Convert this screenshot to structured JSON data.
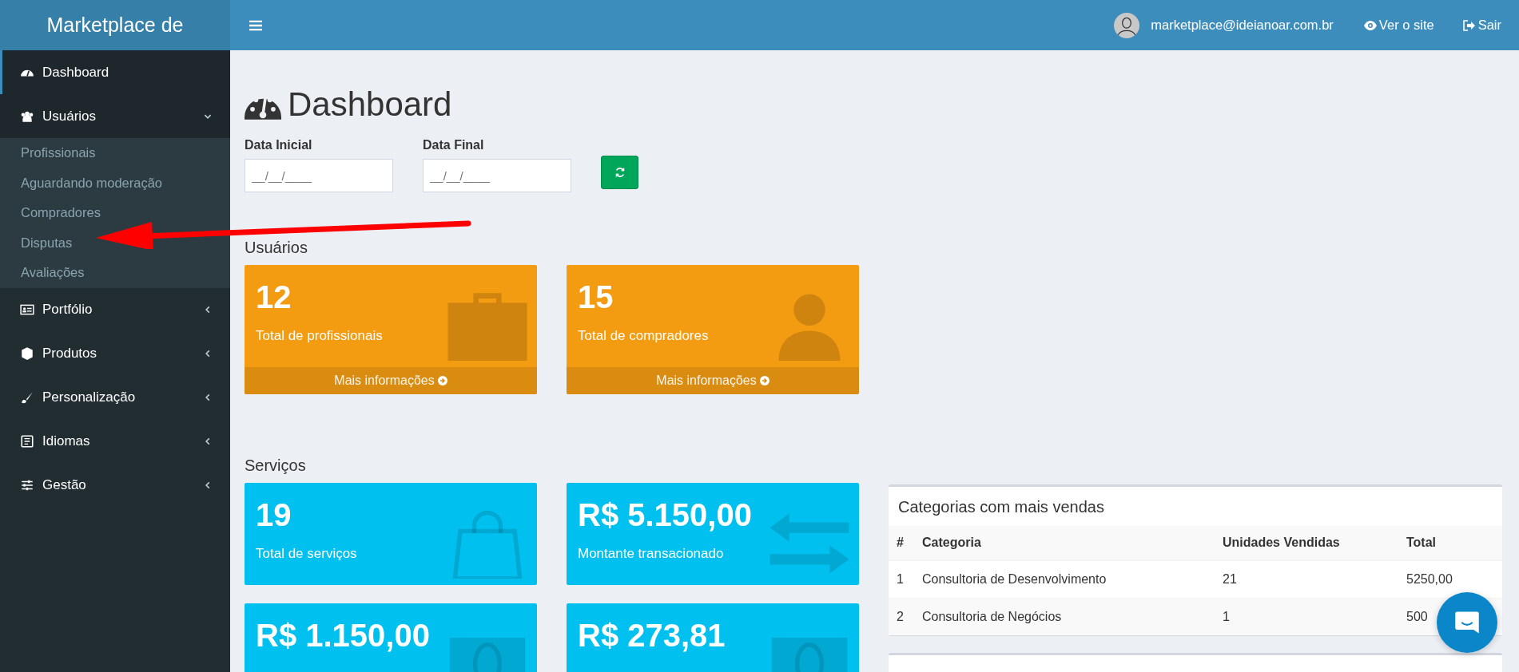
{
  "brand": "Marketplace de",
  "topbar": {
    "user_email": "marketplace@ideianoar.com.br",
    "links": [
      {
        "label": "Ver o site"
      },
      {
        "label": "Sair"
      }
    ]
  },
  "sidebar": {
    "items": [
      {
        "label": "Dashboard",
        "selected": true
      },
      {
        "label": "Usuários",
        "selected": false,
        "expanded": true,
        "children": [
          {
            "label": "Profissionais"
          },
          {
            "label": "Aguardando moderação"
          },
          {
            "label": "Compradores"
          },
          {
            "label": "Disputas"
          },
          {
            "label": "Avaliações"
          }
        ]
      },
      {
        "label": "Portfólio",
        "selected": false,
        "expanded": false
      },
      {
        "label": "Produtos",
        "selected": false,
        "expanded": false
      },
      {
        "label": "Personalização",
        "selected": false,
        "expanded": false
      },
      {
        "label": "Idiomas",
        "selected": false,
        "expanded": false
      },
      {
        "label": "Gestão",
        "selected": false,
        "expanded": false
      }
    ]
  },
  "page": {
    "title": "Dashboard",
    "filters": [
      {
        "label": "Data Inicial",
        "placeholder": "__/__/____"
      },
      {
        "label": "Data Final",
        "placeholder": "__/__/____"
      }
    ]
  },
  "sections": [
    {
      "title": "Usuários",
      "color": "#f39c12",
      "cards": [
        {
          "value": "12",
          "label": "Total de profissionais",
          "footer": "Mais informações"
        },
        {
          "value": "15",
          "label": "Total de compradores",
          "footer": "Mais informações"
        }
      ]
    },
    {
      "title": "Serviços",
      "color": "#00c0ef",
      "cards": [
        {
          "value": "19",
          "label": "Total de serviços"
        },
        {
          "value": "R$ 5.150,00",
          "label": "Montante transacionado"
        },
        {
          "value": "R$ 1.150,00"
        },
        {
          "value": "R$ 273,81"
        }
      ]
    }
  ],
  "panels": [
    {
      "title": "Categorias com mais vendas",
      "table": {
        "columns": [
          "#",
          "Categoria",
          "Unidades Vendidas",
          "Total"
        ],
        "rows": [
          [
            "1",
            "Consultoria de Desenvolvimento",
            "21",
            "5250,00"
          ],
          [
            "2",
            "Consultoria de Negócios",
            "1",
            "500"
          ]
        ]
      }
    }
  ]
}
